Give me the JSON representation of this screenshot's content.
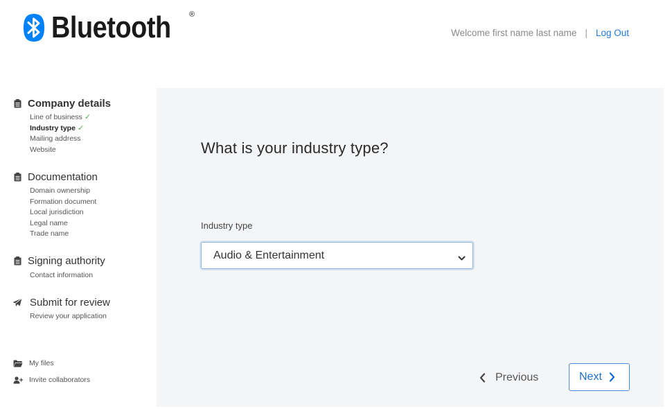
{
  "header": {
    "logo_text": "Bluetooth",
    "logo_mark": "®",
    "welcome": "Welcome first name last name",
    "separator": "|",
    "logout": "Log Out"
  },
  "sidebar": {
    "sections": [
      {
        "title": "Company details",
        "icon": "clipboard-icon",
        "items": [
          {
            "label": "Line of business",
            "check": "✓"
          },
          {
            "label": "Industry type",
            "check": "✓"
          },
          {
            "label": "Mailing address"
          },
          {
            "label": "Website"
          }
        ]
      },
      {
        "title": "Documentation",
        "icon": "clipboard-icon",
        "items": [
          {
            "label": "Domain ownership"
          },
          {
            "label": "Formation document"
          },
          {
            "label": "Local jurisdiction"
          },
          {
            "label": "Legal name"
          },
          {
            "label": "Trade name"
          }
        ]
      },
      {
        "title": "Signing authority",
        "icon": "clipboard-icon",
        "items": [
          {
            "label": "Contact information"
          }
        ]
      },
      {
        "title": "Submit for review",
        "icon": "paper-plane-icon",
        "items": [
          {
            "label": "Review your application"
          }
        ]
      }
    ],
    "footer": [
      {
        "label": "My files",
        "icon": "folder-icon"
      },
      {
        "label": "Invite collaborators",
        "icon": "add-user-icon"
      }
    ]
  },
  "main": {
    "question": "What is your industry type?",
    "field_label": "Industry type",
    "selected_value": "Audio & Entertainment",
    "previous": "Previous",
    "next": "Next"
  },
  "colors": {
    "accent": "#1f7ad6",
    "check": "#4caf50",
    "panel_bg": "#f4f5f7",
    "logo_blue": "#0082fc"
  }
}
